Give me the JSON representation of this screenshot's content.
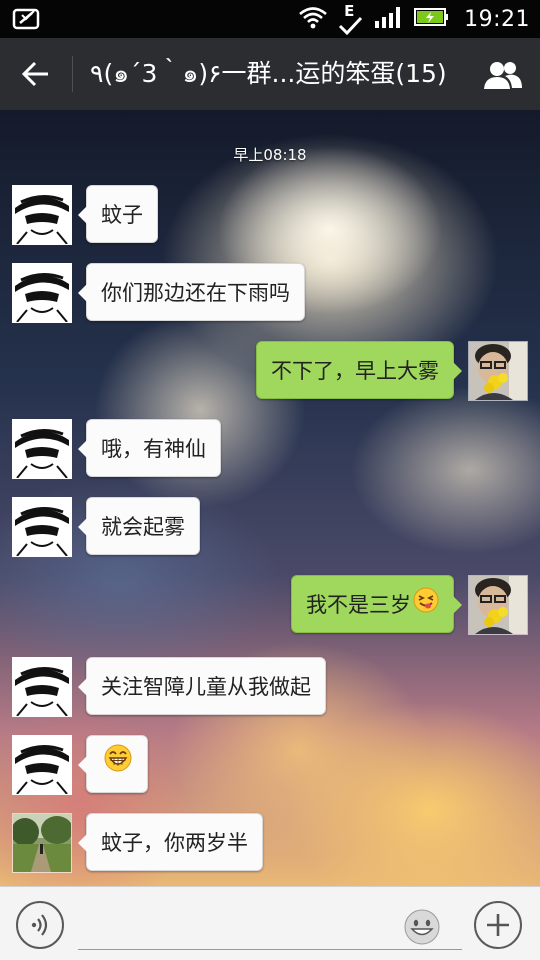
{
  "status_bar": {
    "network_label": "E",
    "time": "19:21"
  },
  "header": {
    "title": "٩(๑´3｀๑)۶一群...运的笨蛋(15)"
  },
  "chat": {
    "timestamp": "早上08:18",
    "messages": [
      {
        "direction": "in",
        "avatar": "comic-avatar",
        "text": "蚊子"
      },
      {
        "direction": "in",
        "avatar": "comic-avatar",
        "text": "你们那边还在下雨吗"
      },
      {
        "direction": "out",
        "avatar": "self-photo-avatar",
        "text": "不下了，早上大雾"
      },
      {
        "direction": "in",
        "avatar": "comic-avatar",
        "text": "哦，有神仙"
      },
      {
        "direction": "in",
        "avatar": "comic-avatar",
        "text": "就会起雾"
      },
      {
        "direction": "out",
        "avatar": "self-photo-avatar",
        "text": "我不是三岁",
        "emoji": "squint-tongue-emoji"
      },
      {
        "direction": "in",
        "avatar": "comic-avatar",
        "text": "关注智障儿童从我做起"
      },
      {
        "direction": "in",
        "avatar": "comic-avatar",
        "text": "",
        "emoji": "grin-emoji"
      },
      {
        "direction": "in",
        "avatar": "park-photo-avatar",
        "text": "蚊子，你两岁半"
      }
    ]
  },
  "input_bar": {
    "placeholder": "",
    "value": ""
  },
  "colors": {
    "header_bg": "#2b2d31",
    "outgoing_bubble": "#9fd85c",
    "incoming_bubble": "#fbfbfb",
    "input_bar_bg": "#f4f4f4"
  }
}
